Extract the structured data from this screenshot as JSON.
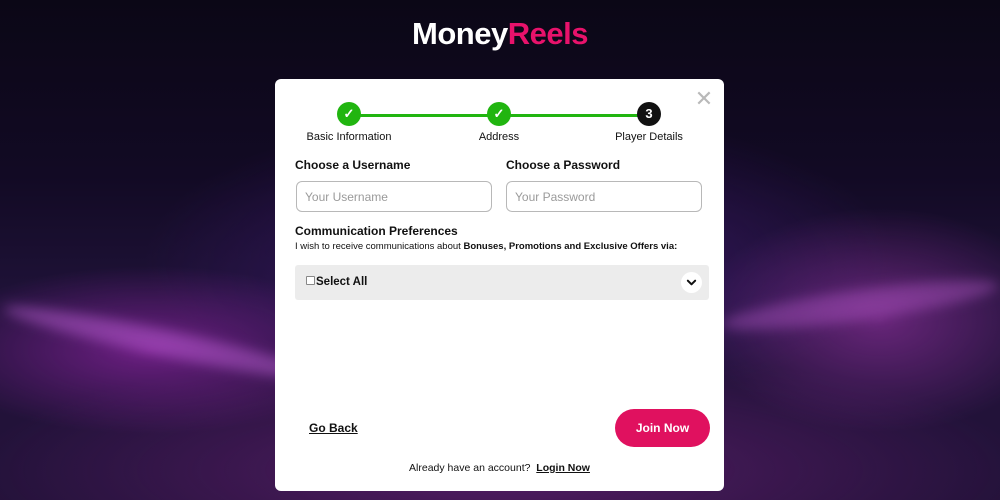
{
  "brand": {
    "part1": "Money",
    "part2": "Reels"
  },
  "modal": {
    "close_glyph": "✕"
  },
  "stepper": {
    "steps": [
      {
        "label": "Basic Information",
        "status": "done",
        "marker": "✓"
      },
      {
        "label": "Address",
        "status": "done",
        "marker": "✓"
      },
      {
        "label": "Player Details",
        "status": "current",
        "marker": "3"
      }
    ]
  },
  "form": {
    "username": {
      "label": "Choose a Username",
      "placeholder": "Your Username",
      "value": ""
    },
    "password": {
      "label": "Choose a Password",
      "placeholder": "Your Password",
      "value": ""
    }
  },
  "preferences": {
    "title": "Communication Preferences",
    "desc_prefix": "I wish to receive communications about ",
    "desc_bold": "Bonuses, Promotions and Exclusive Offers via:",
    "select_all_label": "Select All",
    "select_all_checked": false,
    "chevron_glyph": "⌄"
  },
  "actions": {
    "go_back": "Go Back",
    "join_now": "Join Now"
  },
  "footer": {
    "prompt": "Already have an account?",
    "login": "Login Now"
  },
  "colors": {
    "accent": "#e0115f",
    "success": "#21b510",
    "brand_pink": "#e8126b"
  }
}
